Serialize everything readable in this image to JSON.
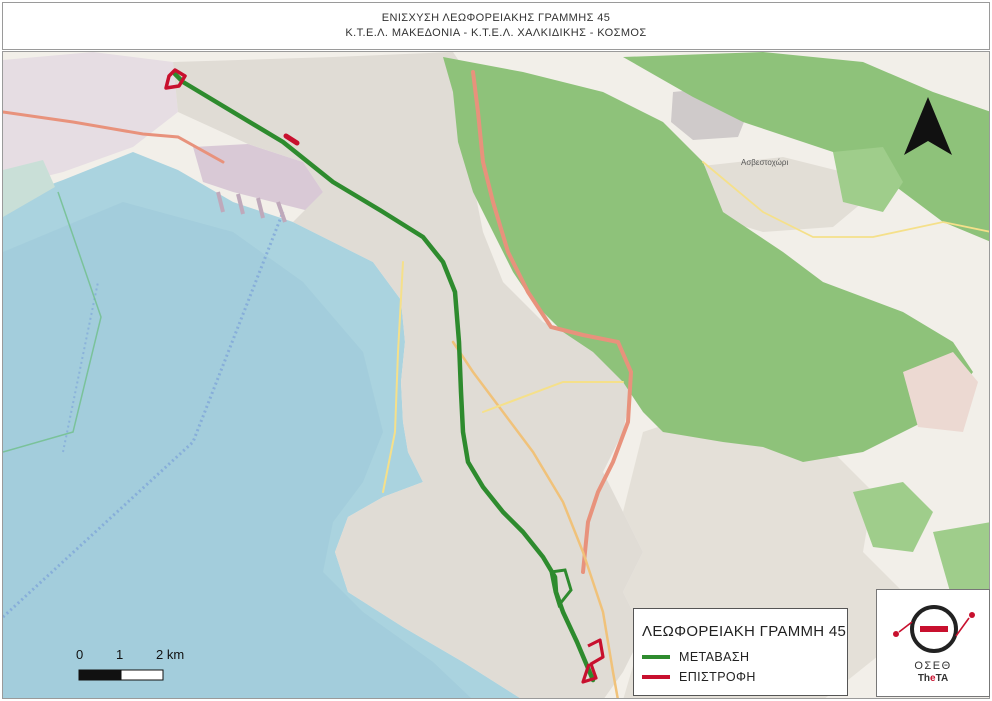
{
  "header": {
    "title_line1": "ΕΝΙΣΧΥΣΗ ΛΕΩΦΟΡΕΙΑΚΗΣ ΓΡΑΜΜΗΣ 45",
    "title_line2": "Κ.Τ.Ε.Λ. ΜΑΚΕΔΟΝΙΑ - Κ.Τ.Ε.Λ. ΧΑΛΚΙΔΙΚΗΣ - ΚΟΣΜΟΣ"
  },
  "legend": {
    "title": "ΛΕΩΦΟΡΕΙΑΚΗ ΓΡΑΜΜΗ 45",
    "items": [
      {
        "label": "ΜΕΤΑΒΑΣΗ",
        "color": "#2e8b2e"
      },
      {
        "label": "ΕΠΙΣΤΡΟΦΗ",
        "color": "#c8102e"
      }
    ]
  },
  "scalebar": {
    "labels": [
      "0",
      "1",
      "2 km"
    ]
  },
  "logo": {
    "name": "ΟΣΕΘ",
    "sub_prefix": "Th",
    "sub_highlight": "e",
    "sub_suffix": "TA",
    "icon": "oseth-logo-icon",
    "colors": {
      "ring": "#222222",
      "bar": "#c8102e"
    }
  },
  "map": {
    "place_label": "Ασβεστοχώρι",
    "colors": {
      "sea": "#aad3df",
      "land": "#f2efe9",
      "forest": "#8ec27a",
      "urban": "#e0dcd5",
      "highway": "#e8927c",
      "route_outbound": "#2e8b2e",
      "route_return": "#c8102e"
    },
    "north_arrow_icon": "north-arrow-icon"
  }
}
